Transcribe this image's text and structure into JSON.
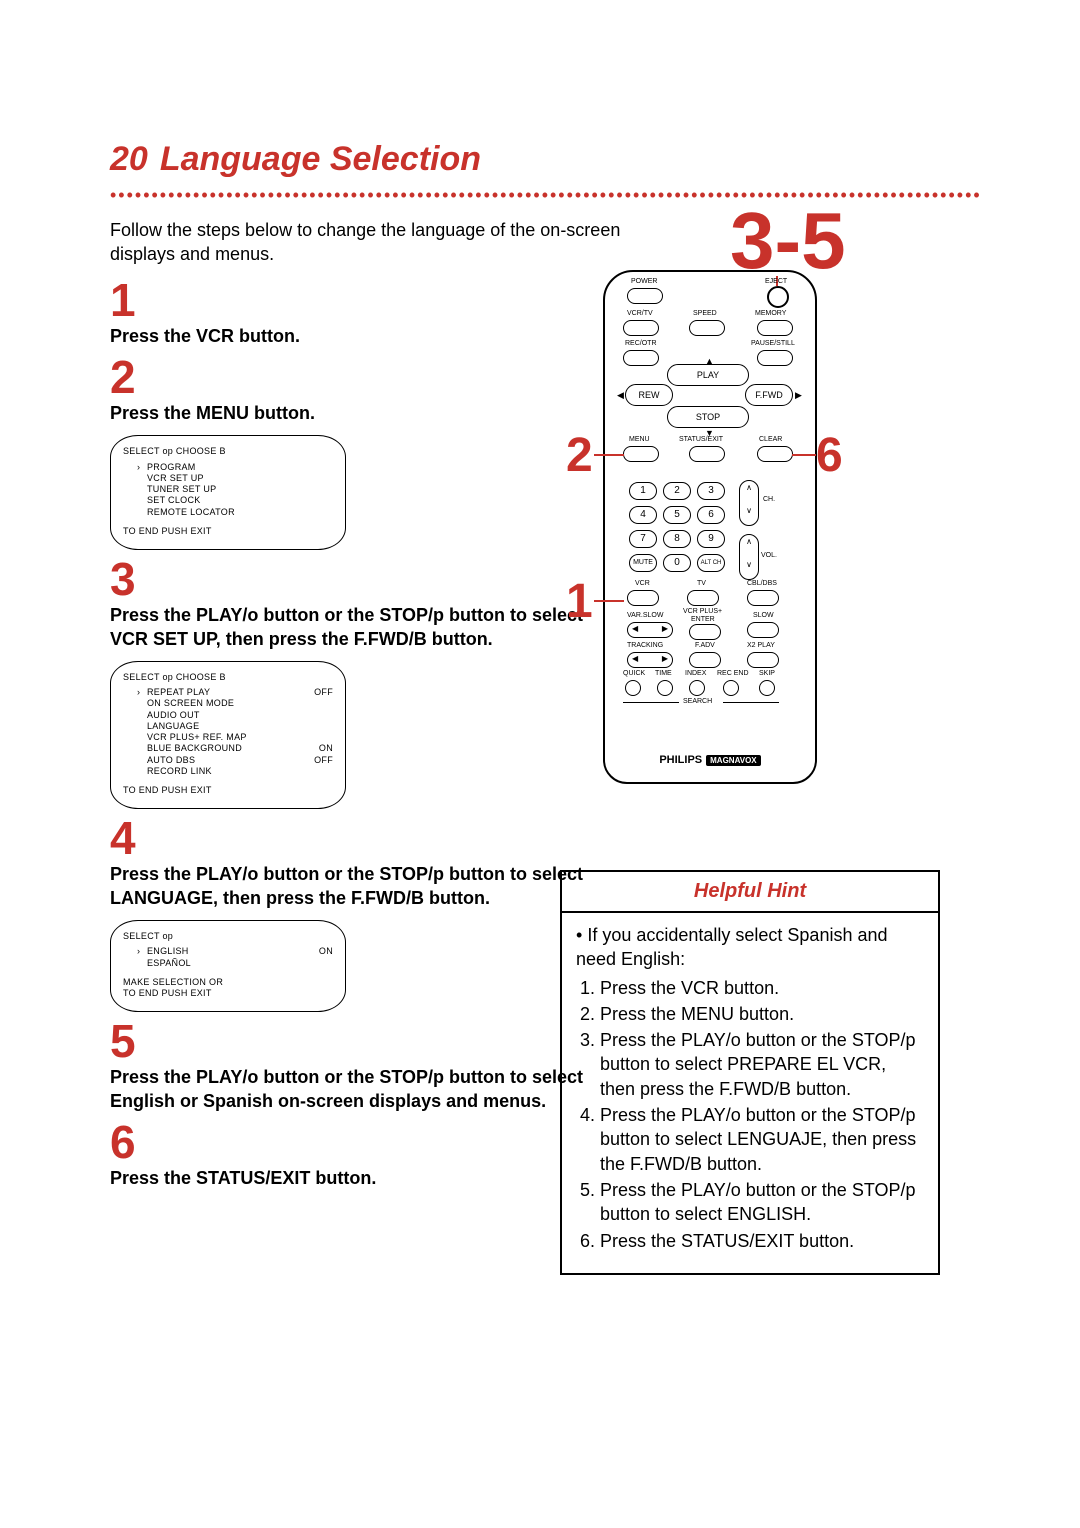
{
  "header": {
    "pageNumber": "20",
    "title": "Language Selection"
  },
  "intro": "Follow the steps below to change the language of the on-screen displays and menus.",
  "steps": {
    "s1": {
      "num": "1",
      "text": "Press the VCR button."
    },
    "s2": {
      "num": "2",
      "text": "Press the MENU button."
    },
    "s3": {
      "num": "3",
      "text": "Press the PLAY/o button or the STOP/p button to select VCR SET UP, then press the F.FWD/B button."
    },
    "s4": {
      "num": "4",
      "text": "Press the PLAY/o button or the STOP/p button to select LANGUAGE, then press the F.FWD/B button."
    },
    "s5": {
      "num": "5",
      "text": "Press the PLAY/o button or the STOP/p button to select English or Spanish on-screen displays and menus."
    },
    "s6": {
      "num": "6",
      "text": "Press the STATUS/EXIT button."
    }
  },
  "screens": {
    "a": {
      "header": "SELECT op    CHOOSE B",
      "items": [
        "PROGRAM",
        "VCR SET UP",
        "TUNER SET UP",
        "SET CLOCK",
        "REMOTE LOCATOR"
      ],
      "footer": "TO END PUSH EXIT"
    },
    "b": {
      "header": "SELECT op    CHOOSE B",
      "rows": [
        {
          "l": "REPEAT PLAY",
          "r": "OFF"
        },
        {
          "l": "ON SCREEN MODE",
          "r": ""
        },
        {
          "l": "AUDIO OUT",
          "r": ""
        },
        {
          "l": "LANGUAGE",
          "r": ""
        },
        {
          "l": "VCR PLUS+ REF. MAP",
          "r": ""
        },
        {
          "l": "BLUE BACKGROUND",
          "r": "ON"
        },
        {
          "l": "AUTO DBS",
          "r": "OFF"
        },
        {
          "l": "RECORD LINK",
          "r": ""
        }
      ],
      "footer": "TO END PUSH EXIT"
    },
    "c": {
      "header": "SELECT op",
      "rows": [
        {
          "l": "ENGLISH",
          "r": "ON"
        },
        {
          "l": "ESPAÑOL",
          "r": ""
        }
      ],
      "footer1": "MAKE SELECTION OR",
      "footer2": "TO END PUSH EXIT"
    }
  },
  "big35": "3-5",
  "callouts": {
    "c2": "2",
    "c6": "6",
    "c1": "1"
  },
  "remote": {
    "labels": {
      "power": "POWER",
      "eject": "EJECT",
      "vcrtv": "VCR/TV",
      "speed": "SPEED",
      "memory": "MEMORY",
      "recotr": "REC/OTR",
      "pause": "PAUSE/STILL",
      "play": "PLAY",
      "rew": "REW",
      "ffwd": "F.FWD",
      "stop": "STOP",
      "menu": "MENU",
      "status": "STATUS/EXIT",
      "clear": "CLEAR",
      "mute": "MUTE",
      "altch": "ALT CH",
      "ch": "CH.",
      "vol": "VOL.",
      "vcr": "VCR",
      "tv": "TV",
      "cbldbs": "CBL/DBS",
      "varslow": "VAR.SLOW",
      "vcrplus": "VCR PLUS+",
      "enter": "ENTER",
      "slow": "SLOW",
      "tracking": "TRACKING",
      "fadv": "F.ADV",
      "x2play": "X2 PLAY",
      "quick": "QUICK",
      "time": "TIME",
      "index": "INDEX",
      "recend": "REC END",
      "skip": "SKIP",
      "search": "SEARCH"
    },
    "brand": "PHILIPS",
    "brand2": "MAGNAVOX",
    "nums": [
      "1",
      "2",
      "3",
      "4",
      "5",
      "6",
      "7",
      "8",
      "9",
      "0"
    ]
  },
  "hint": {
    "title": "Helpful Hint",
    "lead": "If you accidentally select Spanish and need English:",
    "items": [
      "Press the VCR button.",
      "Press the MENU button.",
      "Press the PLAY/o button or the STOP/p button to select PREPARE EL VCR, then press the F.FWD/B button.",
      "Press the PLAY/o button or the STOP/p button to select LENGUAJE, then press the F.FWD/B button.",
      "Press the PLAY/o button or the STOP/p button to select ENGLISH.",
      "Press the STATUS/EXIT button."
    ]
  }
}
